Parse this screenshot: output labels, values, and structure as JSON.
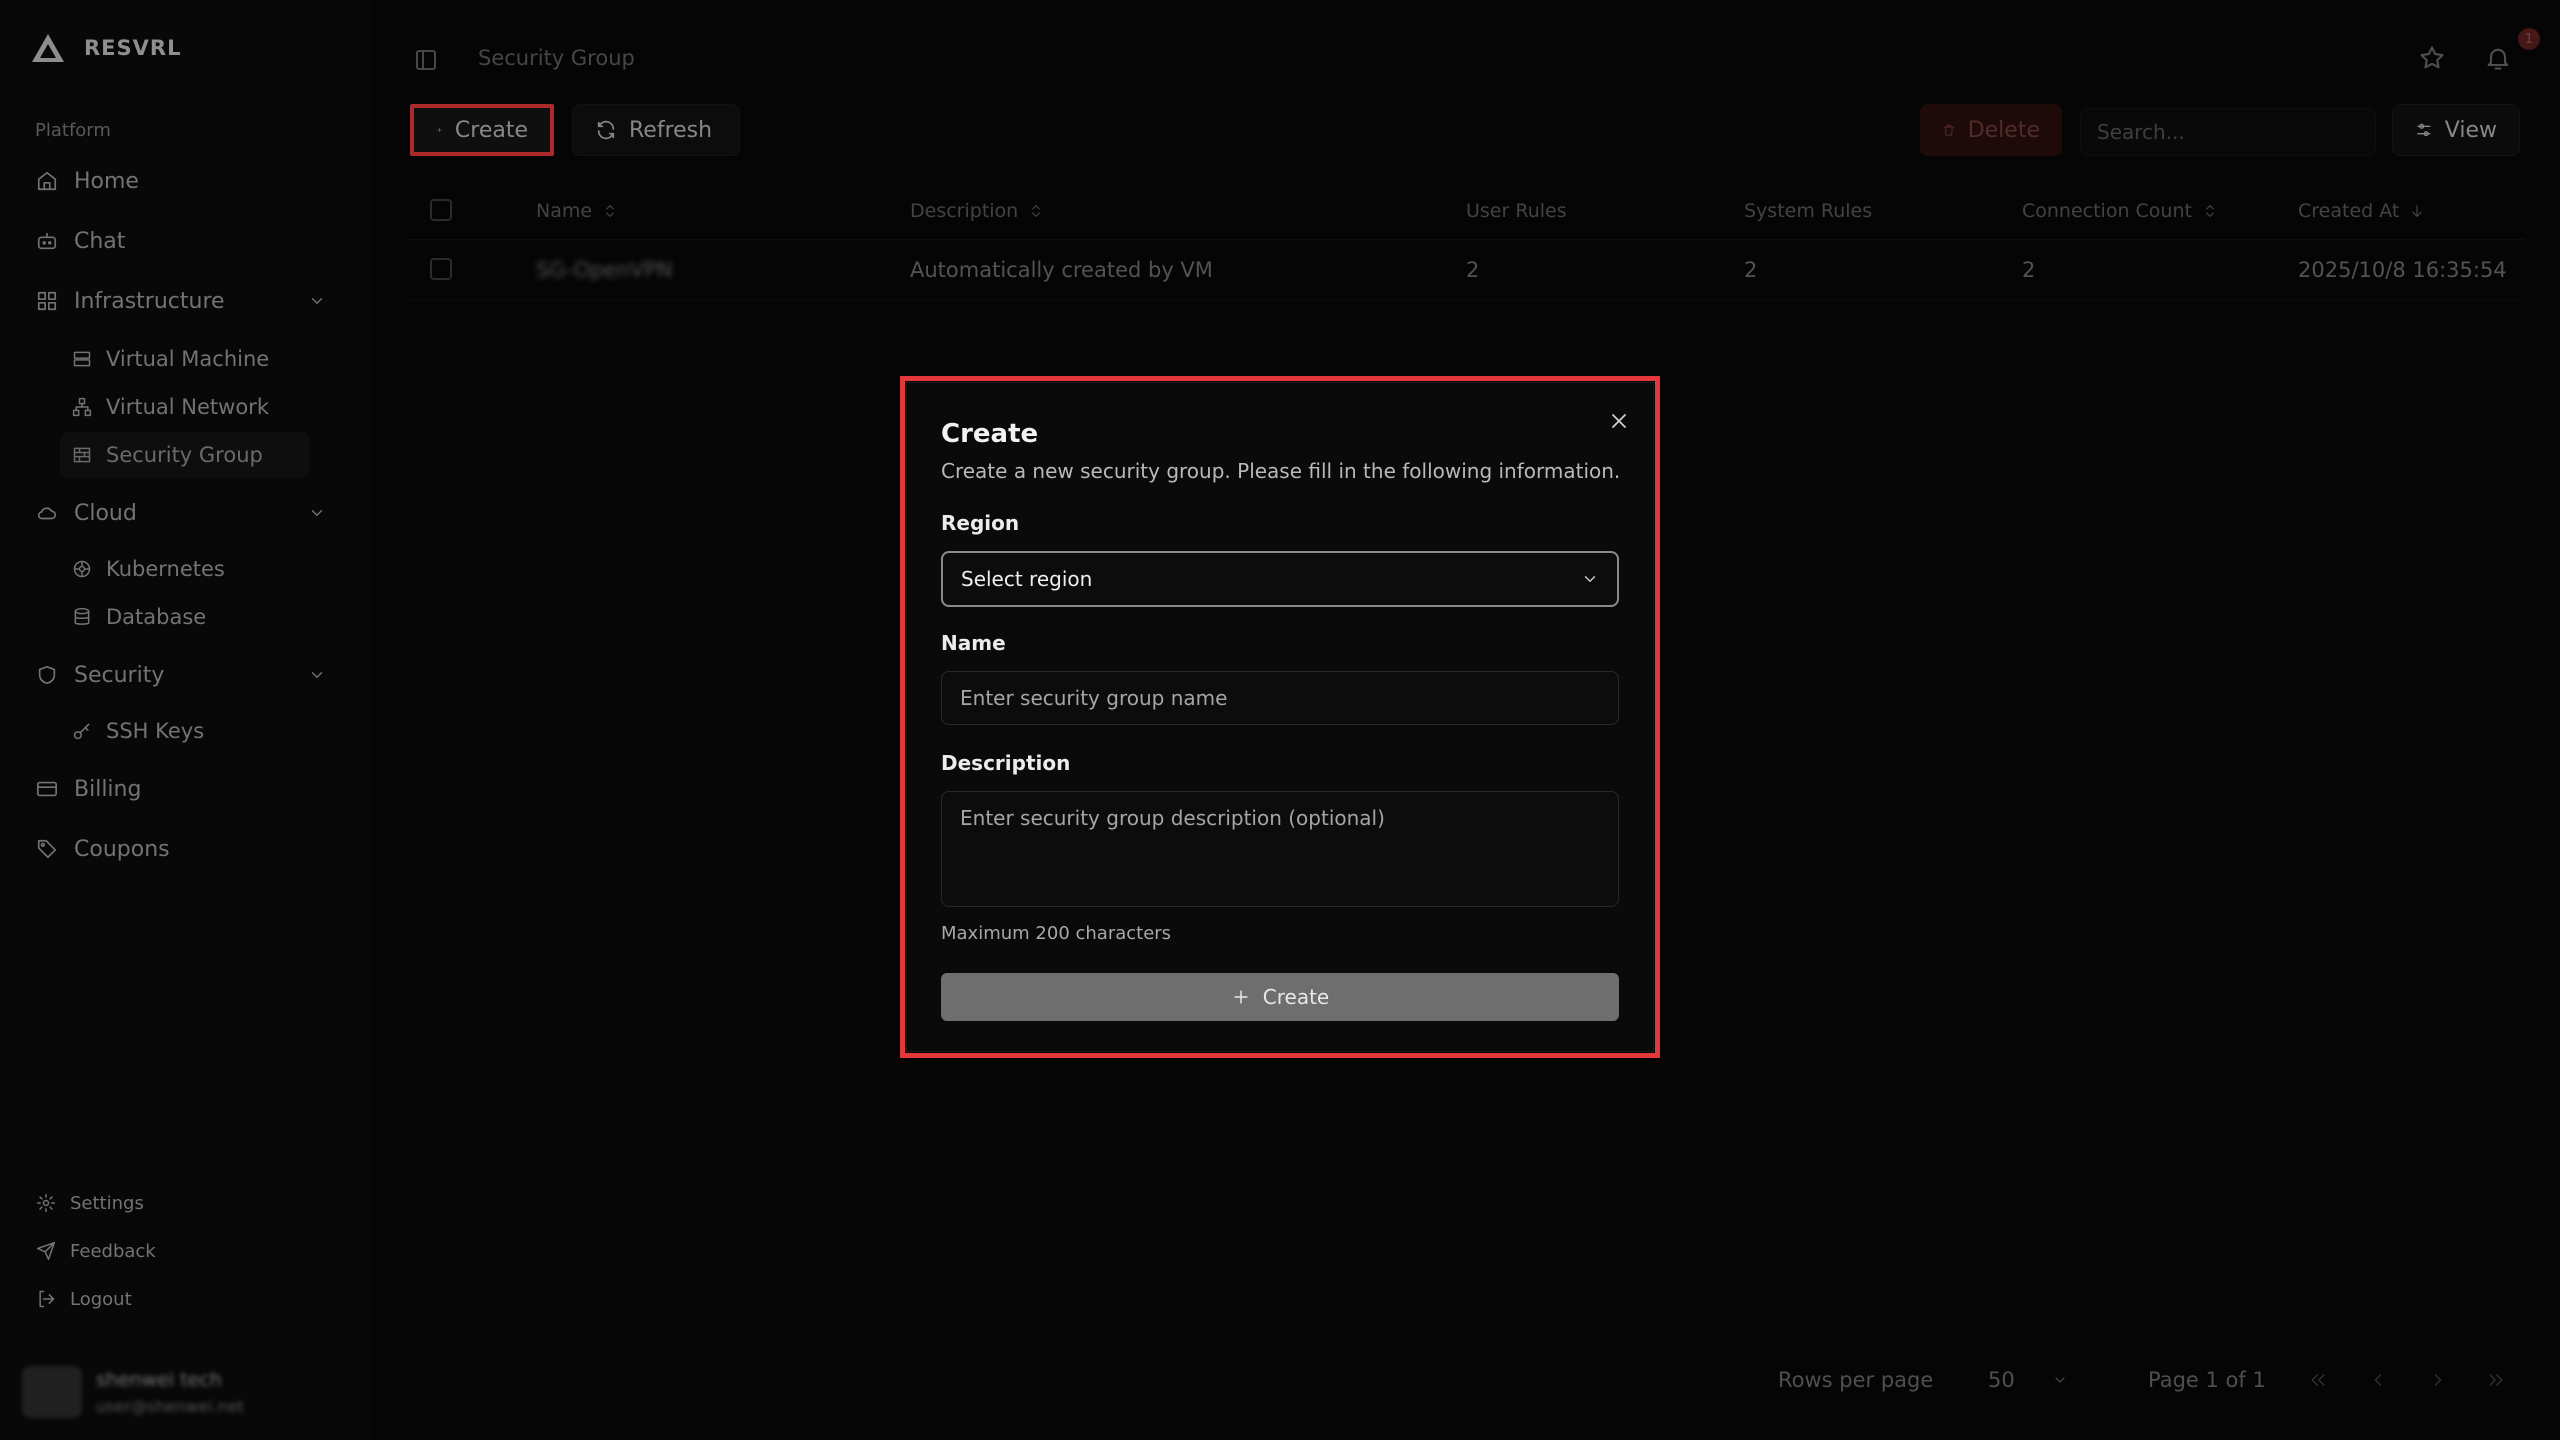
{
  "brand": {
    "name": "RESVRL"
  },
  "sidebar": {
    "section_label": "Platform",
    "items": {
      "home": "Home",
      "chat": "Chat",
      "infrastructure": "Infrastructure",
      "virtual_machine": "Virtual Machine",
      "virtual_network": "Virtual Network",
      "security_group": "Security Group",
      "cloud": "Cloud",
      "kubernetes": "Kubernetes",
      "database": "Database",
      "security": "Security",
      "ssh_keys": "SSH Keys",
      "billing": "Billing",
      "coupons": "Coupons",
      "settings": "Settings",
      "feedback": "Feedback",
      "logout": "Logout"
    },
    "user": {
      "name": "shenwei tech",
      "email": "user@shenwei.net"
    }
  },
  "header": {
    "title": "Security Group",
    "notification_count": "1"
  },
  "toolbar": {
    "create": "Create",
    "refresh": "Refresh",
    "delete": "Delete",
    "search_placeholder": "Search...",
    "view": "View"
  },
  "table": {
    "headers": {
      "name": "Name",
      "description": "Description",
      "user_rules": "User Rules",
      "system_rules": "System Rules",
      "connection_count": "Connection Count",
      "created_at": "Created At"
    },
    "rows": [
      {
        "name": "SG-OpenVPN",
        "description": "Automatically created by VM",
        "user_rules": "2",
        "system_rules": "2",
        "connection_count": "2",
        "created_at": "2025/10/8 16:35:54"
      }
    ]
  },
  "pagination": {
    "rows_per_page_label": "Rows per page",
    "rows_per_page_value": "50",
    "page_info": "Page 1 of 1"
  },
  "modal": {
    "title": "Create",
    "description": "Create a new security group. Please fill in the following information.",
    "region_label": "Region",
    "region_value": "Select region",
    "name_label": "Name",
    "name_placeholder": "Enter security group name",
    "description_label": "Description",
    "description_placeholder": "Enter security group description (optional)",
    "hint": "Maximum 200 characters",
    "submit": "Create"
  },
  "colors": {
    "highlight": "#e5383b",
    "background": "#070707",
    "submit_bg": "#6e6e6e"
  }
}
